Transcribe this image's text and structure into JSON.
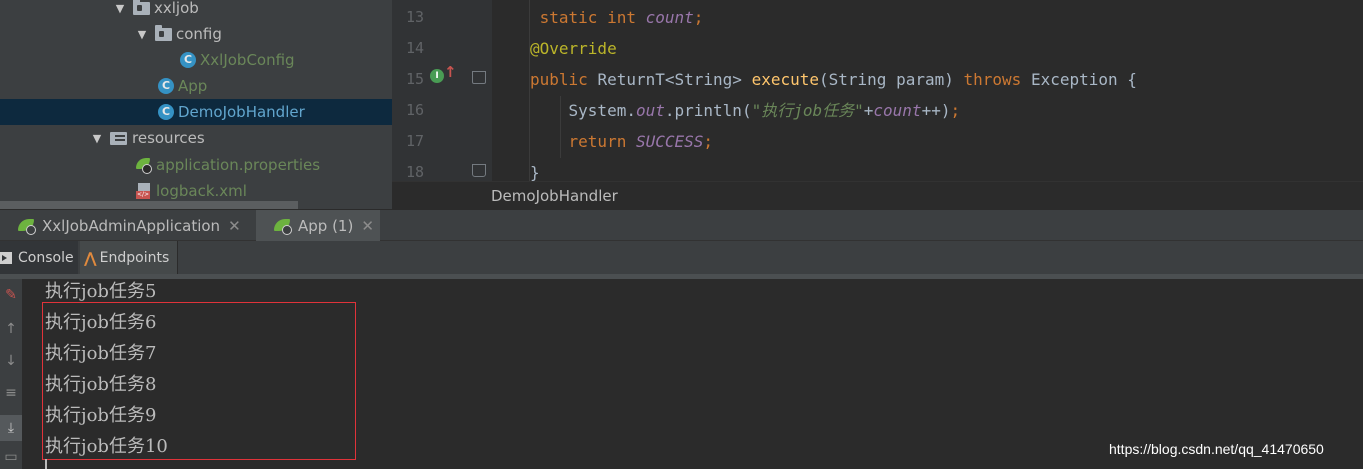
{
  "project_tree": {
    "items": [
      {
        "label": "xxljob",
        "kind": "folder",
        "expanded": true
      },
      {
        "label": "config",
        "kind": "folder",
        "expanded": true
      },
      {
        "label": "XxlJobConfig",
        "kind": "class"
      },
      {
        "label": "App",
        "kind": "spring-class"
      },
      {
        "label": "DemoJobHandler",
        "kind": "class",
        "selected": true
      },
      {
        "label": "resources",
        "kind": "resources-folder",
        "expanded": true
      },
      {
        "label": "application.properties",
        "kind": "properties-file"
      },
      {
        "label": "logback.xml",
        "kind": "xml-file"
      }
    ]
  },
  "editor": {
    "line_numbers": [
      "13",
      "14",
      "15",
      "16",
      "17",
      "18"
    ],
    "lines": [
      [
        {
          "t": " static int ",
          "c": "kw"
        },
        {
          "t": "count",
          "c": "fld"
        },
        {
          "t": ";",
          "c": "kw"
        }
      ],
      [
        {
          "t": "@Override",
          "c": "ann"
        }
      ],
      [
        {
          "t": "public ",
          "c": "kw"
        },
        {
          "t": "ReturnT<String> ",
          "c": "txt"
        },
        {
          "t": "execute",
          "c": "fn"
        },
        {
          "t": "(String param) ",
          "c": "txt"
        },
        {
          "t": "throws ",
          "c": "kw"
        },
        {
          "t": "Exception {",
          "c": "txt"
        }
      ],
      [
        {
          "t": "    System.",
          "c": "txt"
        },
        {
          "t": "out",
          "c": "fld"
        },
        {
          "t": ".println(",
          "c": "txt"
        },
        {
          "t": "\"执行job任务\"",
          "c": "str"
        },
        {
          "t": "+",
          "c": "txt"
        },
        {
          "t": "count",
          "c": "fld"
        },
        {
          "t": "++)",
          "c": "txt"
        },
        {
          "t": ";",
          "c": "kw"
        }
      ],
      [
        {
          "t": "    return ",
          "c": "kw"
        },
        {
          "t": "SUCCESS",
          "c": "cst"
        },
        {
          "t": ";",
          "c": "kw"
        }
      ],
      [
        {
          "t": "}",
          "c": "txt"
        }
      ]
    ],
    "breadcrumb": "DemoJobHandler",
    "gutter_icon": "I"
  },
  "run_tabs": [
    {
      "label": "XxlJobAdminApplication",
      "active": false
    },
    {
      "label": "App (1)",
      "active": true
    }
  ],
  "tool_tabs": {
    "console": "Console",
    "endpoints": "Endpoints"
  },
  "console": {
    "lines": [
      "执行job任务5",
      "执行job任务6",
      "执行job任务7",
      "执行job任务8",
      "执行job任务9",
      "执行job任务10"
    ]
  },
  "watermark": "https://blog.csdn.net/qq_41470650",
  "colors": {
    "highlight_box": "#e0333a",
    "selection": "#0d293e",
    "keyword": "#cc7832",
    "annotation": "#bbb529",
    "string": "#6a8759",
    "field": "#9876aa",
    "method": "#ffc66d"
  }
}
